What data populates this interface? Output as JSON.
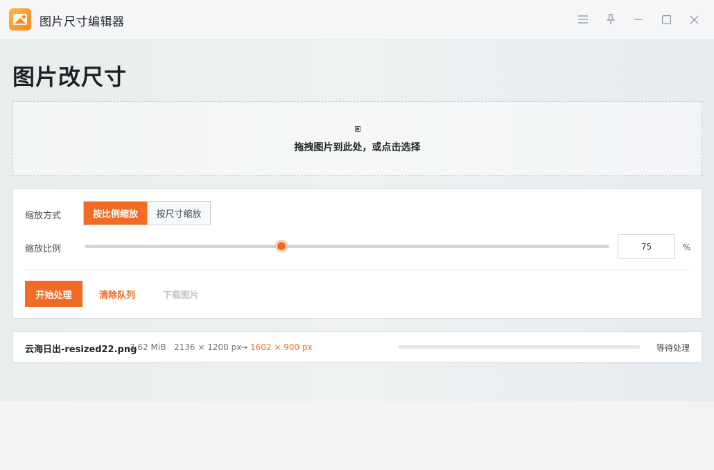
{
  "window": {
    "title": "图片尺寸编辑器",
    "controls": [
      "menu-icon",
      "pin-icon",
      "minimize-icon",
      "maximize-icon",
      "close-icon"
    ]
  },
  "page": {
    "heading": "图片改尺寸"
  },
  "dropzone": {
    "text": "拖拽图片到此处，或点击选择"
  },
  "settings": {
    "mode_label": "缩放方式",
    "modes": [
      "按比例缩放",
      "按尺寸缩放"
    ],
    "selected_mode": "按比例缩放",
    "ratio_label": "缩放比例",
    "ratio_value": "75",
    "ratio_fraction": 0.375,
    "unit": "%"
  },
  "actions": {
    "start": "开始处理",
    "clear": "清除队列",
    "download": "下载图片"
  },
  "queue": [
    {
      "name": "云海日出-resized22.png",
      "size": "3.62 MiB",
      "original_dims": "2136 × 1200 px",
      "arrow": "→",
      "new_dims": "1602 × 900 px",
      "progress": 0,
      "status": "等待处理"
    }
  ],
  "colors": {
    "accent": "#f26a24",
    "disabled": "#c3c7cb"
  }
}
